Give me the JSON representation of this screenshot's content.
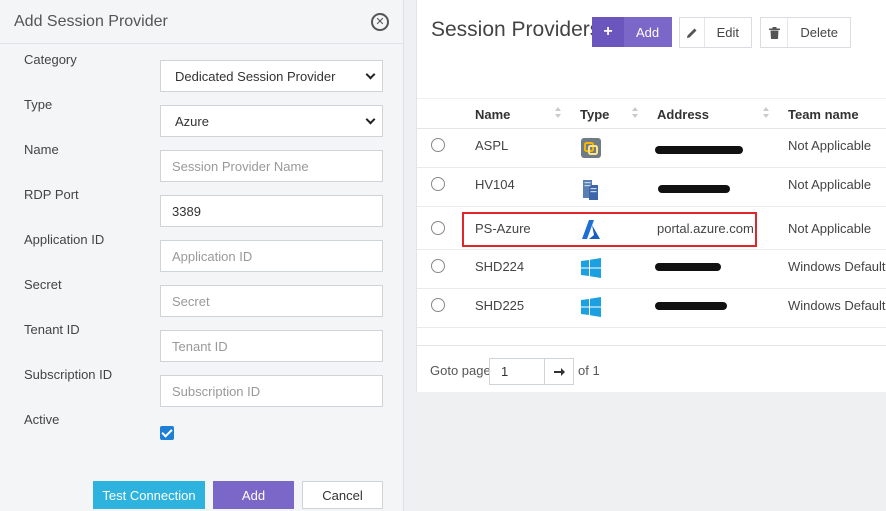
{
  "dialog": {
    "title": "Add Session Provider",
    "close_icon": "times-circle-icon",
    "fields": [
      {
        "label": "Category",
        "value": "Dedicated Session Provider",
        "kind": "select"
      },
      {
        "label": "Type",
        "value": "Azure",
        "kind": "select"
      },
      {
        "label": "Name",
        "placeholder": "Session Provider Name",
        "value": ""
      },
      {
        "label": "RDP Port",
        "value": "3389"
      },
      {
        "label": "Application ID",
        "placeholder": "Application ID",
        "value": ""
      },
      {
        "label": "Secret",
        "placeholder": "Secret",
        "value": ""
      },
      {
        "label": "Tenant ID",
        "placeholder": "Tenant ID",
        "value": ""
      },
      {
        "label": "Subscription ID",
        "placeholder": "Subscription ID",
        "value": ""
      },
      {
        "label": "Active",
        "checked": true,
        "kind": "checkbox"
      }
    ],
    "buttons": {
      "test": "Test Connection",
      "add": "Add",
      "cancel": "Cancel"
    }
  },
  "panel": {
    "title": "Session Providers",
    "toolbar": {
      "add": "Add",
      "edit": "Edit",
      "delete": "Delete"
    },
    "columns": [
      "Name",
      "Type",
      "Address",
      "Team name"
    ],
    "rows": [
      {
        "name": "ASPL",
        "type_icon": "vmware-icon",
        "address": "",
        "team": "Not Applicable"
      },
      {
        "name": "HV104",
        "type_icon": "hyperv-server-icon",
        "address": "",
        "team": "Not Applicable"
      },
      {
        "name": "PS-Azure",
        "type_icon": "azure-icon",
        "address": "portal.azure.com",
        "team": "Not Applicable"
      },
      {
        "name": "SHD224",
        "type_icon": "windows-icon",
        "address": "",
        "team": "Windows Default"
      },
      {
        "name": "SHD225",
        "type_icon": "windows-icon",
        "address": "",
        "team": "Windows Default"
      }
    ],
    "pager": {
      "label": "Goto page",
      "page": "1",
      "of": "of 1"
    }
  },
  "colors": {
    "primary_purple": "#7a67c7",
    "info_blue": "#2eb2de",
    "highlight_red": "#e2242b"
  }
}
